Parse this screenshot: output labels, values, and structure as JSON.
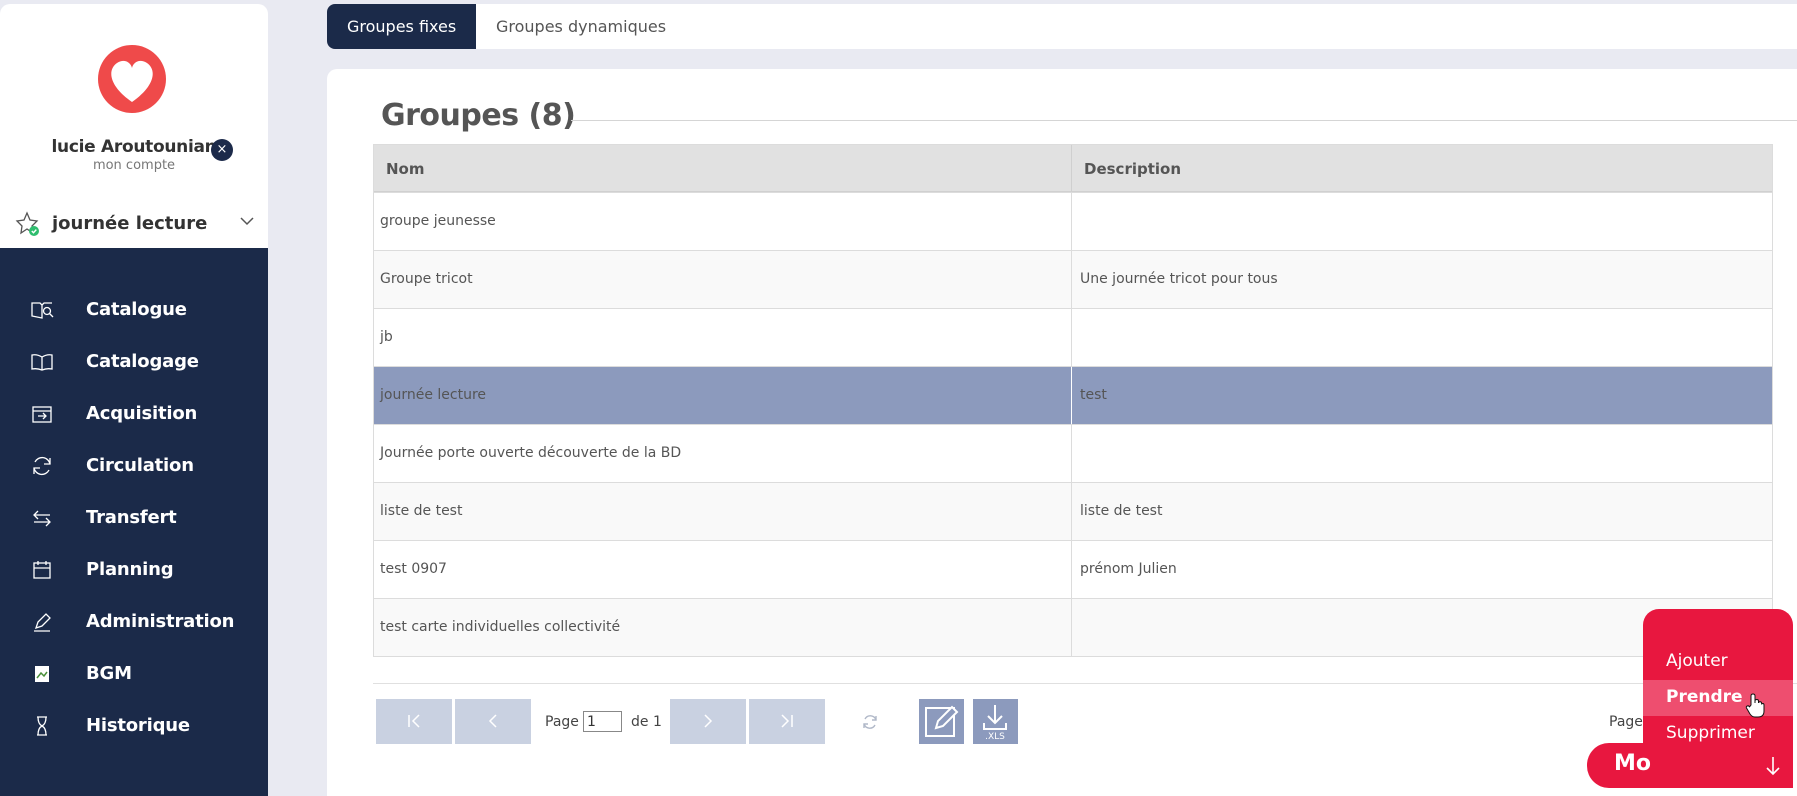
{
  "user": {
    "name": "lucie Aroutounian",
    "account_link": "mon compte"
  },
  "current_group": "journée lecture",
  "nav": [
    {
      "label": "Catalogue",
      "icon": "book-search-icon"
    },
    {
      "label": "Catalogage",
      "icon": "open-book-icon"
    },
    {
      "label": "Acquisition",
      "icon": "acquisition-icon"
    },
    {
      "label": "Circulation",
      "icon": "refresh-icon"
    },
    {
      "label": "Transfert",
      "icon": "swap-arrows-icon"
    },
    {
      "label": "Planning",
      "icon": "calendar-icon"
    },
    {
      "label": "Administration",
      "icon": "pen-icon"
    },
    {
      "label": "BGM",
      "icon": "broken-image-icon"
    },
    {
      "label": "Historique",
      "icon": "hourglass-icon"
    }
  ],
  "tabs": [
    {
      "label": "Groupes fixes",
      "active": true
    },
    {
      "label": "Groupes dynamiques",
      "active": false
    }
  ],
  "panel": {
    "title": "Groupes (8)"
  },
  "table": {
    "columns": [
      "Nom",
      "Description"
    ],
    "rows": [
      {
        "nom": "groupe jeunesse",
        "description": ""
      },
      {
        "nom": "Groupe tricot",
        "description": "Une journée tricot pour tous"
      },
      {
        "nom": "jb",
        "description": ""
      },
      {
        "nom": "journée lecture",
        "description": "test",
        "selected": true
      },
      {
        "nom": "Journée porte ouverte découverte de la BD",
        "description": ""
      },
      {
        "nom": "liste de test",
        "description": "liste de test"
      },
      {
        "nom": "test 0907",
        "description": "prénom Julien"
      },
      {
        "nom": "test carte individuelles collectivité",
        "description": ""
      }
    ]
  },
  "pager": {
    "page_label": "Page",
    "page_value": "1",
    "of_label": "de 1",
    "right_label": "Page"
  },
  "action_menu": {
    "items": [
      "Ajouter",
      "Prendre",
      "Supprimer"
    ],
    "hovered": "Prendre",
    "button_label": "Mo"
  },
  "colors": {
    "sidebar": "#1b2a49",
    "selected_row": "#8c9abd",
    "accent": "#e8173f"
  }
}
